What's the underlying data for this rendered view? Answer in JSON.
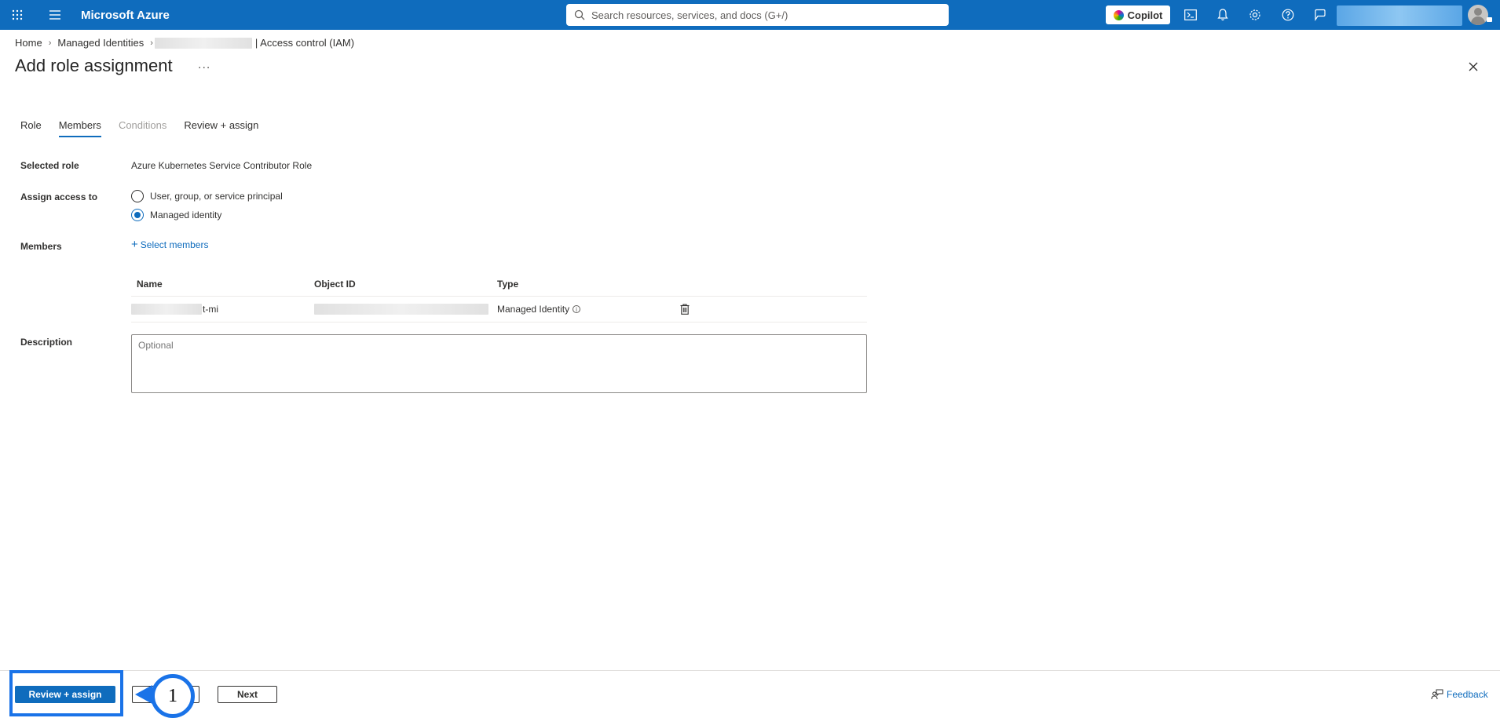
{
  "topbar": {
    "brand": "Microsoft Azure",
    "search_placeholder": "Search resources, services, and docs (G+/)",
    "copilot_label": "Copilot"
  },
  "breadcrumb": {
    "items": [
      "Home",
      "Managed Identities"
    ],
    "current": "| Access control (IAM)"
  },
  "page": {
    "title": "Add role assignment",
    "more": "..."
  },
  "tabs": [
    {
      "label": "Role",
      "state": "normal"
    },
    {
      "label": "Members",
      "state": "active"
    },
    {
      "label": "Conditions",
      "state": "disabled"
    },
    {
      "label": "Review + assign",
      "state": "normal"
    }
  ],
  "form": {
    "selected_role_label": "Selected role",
    "selected_role_value": "Azure Kubernetes Service Contributor Role",
    "assign_access_label": "Assign access to",
    "assign_options": [
      {
        "label": "User, group, or service principal",
        "checked": false
      },
      {
        "label": "Managed identity",
        "checked": true
      }
    ],
    "members_label": "Members",
    "select_members": "Select members",
    "description_label": "Description",
    "description_placeholder": "Optional"
  },
  "members_table": {
    "headers": [
      "Name",
      "Object ID",
      "Type"
    ],
    "rows": [
      {
        "name_suffix": "t-mi",
        "type": "Managed Identity"
      }
    ]
  },
  "footer": {
    "primary": "Review + assign",
    "next": "Next",
    "feedback": "Feedback",
    "callout_number": "1"
  },
  "colors": {
    "azure_blue": "#0f6cbd",
    "highlight_blue": "#1a73e8"
  }
}
